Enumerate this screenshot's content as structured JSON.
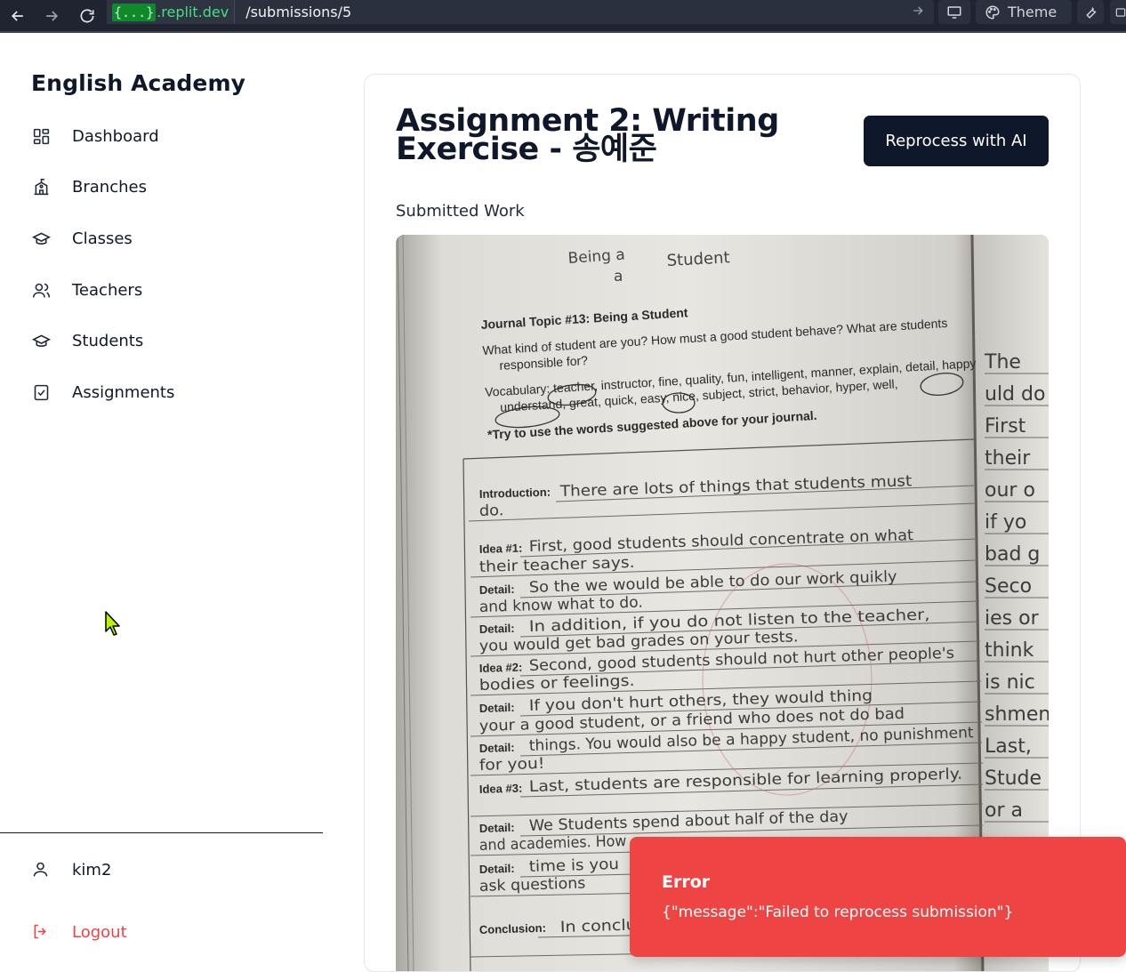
{
  "browser": {
    "url_brace": "{...}",
    "url_host": ".replit.dev",
    "url_path": "/submissions/5",
    "theme_label": "Theme"
  },
  "sidebar": {
    "brand": "English Academy",
    "items": [
      {
        "label": "Dashboard",
        "icon": "dashboard-icon"
      },
      {
        "label": "Branches",
        "icon": "school-building-icon"
      },
      {
        "label": "Classes",
        "icon": "graduation-cap-icon"
      },
      {
        "label": "Teachers",
        "icon": "users-icon"
      },
      {
        "label": "Students",
        "icon": "graduation-cap-icon"
      },
      {
        "label": "Assignments",
        "icon": "clipboard-check-icon"
      }
    ],
    "user": "kim2",
    "logout": "Logout"
  },
  "main": {
    "title": "Assignment 2: Writing Exercise - 송예준",
    "reprocess_button": "Reprocess with AI",
    "section_label": "Submitted Work"
  },
  "notebook": {
    "heading_top": "Being a",
    "heading_mid": "a",
    "heading_right": "Student",
    "topic": "Journal Topic #13: Being a Student",
    "question_1": "What kind of student are you? How must a good student behave? What are students",
    "question_2": "responsible for?",
    "vocab_1": "Vocabulary: teacher, instructor, fine, quality, fun, intelligent, manner, explain, detail, happy",
    "vocab_2": "understand, great, quick, easy, nice, subject, strict, behavior, hyper, well,",
    "tip": "*Try to use the words suggested above for your journal.",
    "lines": [
      {
        "label": "Introduction:",
        "text": "There are lots of things that students must"
      },
      {
        "label": "",
        "text": "do."
      },
      {
        "label": "Idea #1:",
        "text": "First, good students should concentrate on what"
      },
      {
        "label": "",
        "text": "their teacher says."
      },
      {
        "label": "Detail:",
        "text": "So the we would be able to do our work quikly"
      },
      {
        "label": "",
        "text": "and know what to do."
      },
      {
        "label": "Detail:",
        "text": "In addition, if you do not listen to the teacher,"
      },
      {
        "label": "",
        "text": "you would get bad grades on your tests."
      },
      {
        "label": "Idea #2:",
        "text": "Second, good students should not hurt other people's"
      },
      {
        "label": "",
        "text": "bodies or feelings."
      },
      {
        "label": "Detail:",
        "text": "If you don't hurt others, they would thing"
      },
      {
        "label": "",
        "text": "your a good student, or a friend who does not do bad"
      },
      {
        "label": "Detail:",
        "text": "things. You would also be a happy student, no punishment"
      },
      {
        "label": "",
        "text": "for you!"
      },
      {
        "label": "Idea #3:",
        "text": "Last, students are responsible for learning properly."
      },
      {
        "label": "",
        "text": ""
      },
      {
        "label": "Detail:",
        "text": "We Students spend about half of the day"
      },
      {
        "label": "",
        "text": "and academies. How"
      },
      {
        "label": "Detail:",
        "text": "time is you"
      },
      {
        "label": "",
        "text": "ask questions"
      },
      {
        "label": "Conclusion:",
        "text": "In conclusi"
      }
    ],
    "right_page": [
      "The",
      "uld do",
      "First",
      "their",
      "our o",
      "if yo",
      "bad g",
      "Seco",
      "ies or",
      "think",
      "is nic",
      "shmen",
      "Last,",
      "Stude",
      "or a"
    ]
  },
  "toast": {
    "title": "Error",
    "message": "{\"message\":\"Failed to reprocess submission\"}"
  }
}
